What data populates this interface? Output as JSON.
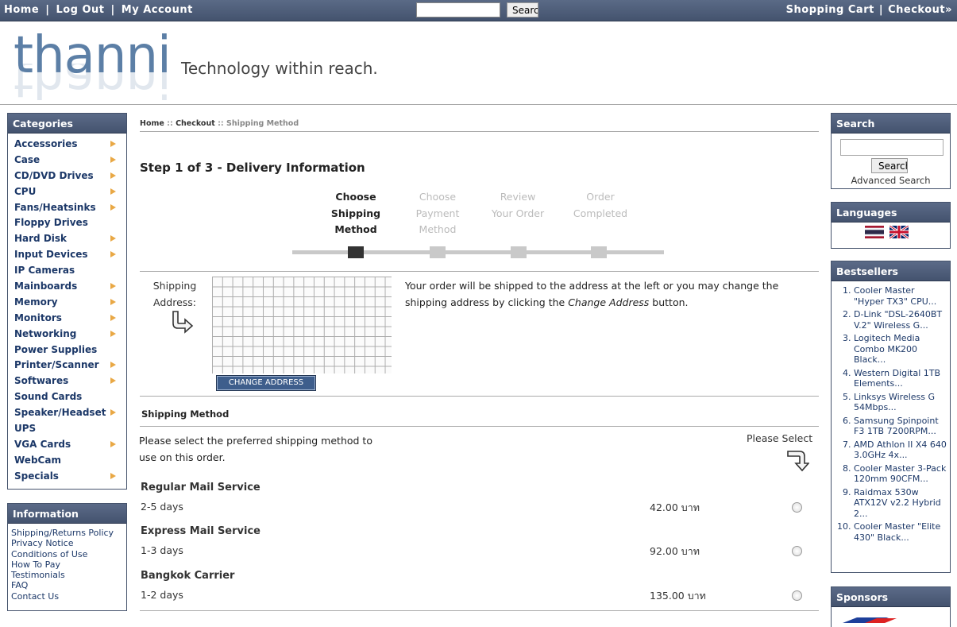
{
  "topnav": {
    "left": [
      "Home",
      "Log Out",
      "My Account"
    ],
    "search_button": "Search",
    "right": [
      "Shopping Cart",
      "Checkout»"
    ]
  },
  "header": {
    "logo": "thanni",
    "tagline": "Technology within reach."
  },
  "categories": {
    "title": "Categories",
    "items": [
      {
        "label": "Accessories",
        "arrow": true
      },
      {
        "label": "Case",
        "arrow": true
      },
      {
        "label": "CD/DVD Drives",
        "arrow": true
      },
      {
        "label": "CPU",
        "arrow": true
      },
      {
        "label": "Fans/Heatsinks",
        "arrow": true
      },
      {
        "label": "Floppy Drives",
        "arrow": false
      },
      {
        "label": "Hard Disk",
        "arrow": true
      },
      {
        "label": "Input Devices",
        "arrow": true
      },
      {
        "label": "IP Cameras",
        "arrow": false
      },
      {
        "label": "Mainboards",
        "arrow": true
      },
      {
        "label": "Memory",
        "arrow": true
      },
      {
        "label": "Monitors",
        "arrow": true
      },
      {
        "label": "Networking",
        "arrow": true
      },
      {
        "label": "Power Supplies",
        "arrow": false
      },
      {
        "label": "Printer/Scanner",
        "arrow": true
      },
      {
        "label": "Softwares",
        "arrow": true
      },
      {
        "label": "Sound Cards",
        "arrow": false
      },
      {
        "label": "Speaker/Headset",
        "arrow": true
      },
      {
        "label": "UPS",
        "arrow": false
      },
      {
        "label": "VGA Cards",
        "arrow": true
      },
      {
        "label": "WebCam",
        "arrow": false
      },
      {
        "label": "Specials",
        "arrow": true
      }
    ]
  },
  "information": {
    "title": "Information",
    "items": [
      "Shipping/Returns Policy",
      "Privacy Notice",
      "Conditions of Use",
      "How To Pay",
      "Testimonials",
      "FAQ",
      "Contact Us"
    ]
  },
  "breadcrumb": {
    "home": "Home",
    "sep": "::",
    "checkout": "Checkout",
    "current": "Shipping Method"
  },
  "main": {
    "step_title": "Step 1 of 3 - Delivery Information",
    "steps": [
      {
        "lines": [
          "Choose",
          "Shipping",
          "Method"
        ]
      },
      {
        "lines": [
          "Choose",
          "Payment",
          "Method"
        ]
      },
      {
        "lines": [
          "Review",
          "Your Order"
        ]
      },
      {
        "lines": [
          "Order",
          "Completed"
        ]
      }
    ],
    "shipping_address_label": [
      "Shipping",
      "Address:"
    ],
    "change_address": "CHANGE ADDRESS",
    "shipping_desc_pre": "Your order will be shipped to the address at the left or you may change the shipping address by clicking the ",
    "shipping_desc_em": "Change Address",
    "shipping_desc_post": " button.",
    "shipping_method_title": "Shipping Method",
    "method_desc": "Please select the preferred shipping method to use on this order.",
    "please_select": "Please Select",
    "services": [
      {
        "name": "Regular Mail Service",
        "days": "2-5 days",
        "price": "42.00 บาท"
      },
      {
        "name": "Express Mail Service",
        "days": "1-3 days",
        "price": "92.00 บาท"
      },
      {
        "name": "Bangkok Carrier",
        "days": "1-2 days",
        "price": "135.00 บาท"
      }
    ]
  },
  "side_search": {
    "title": "Search",
    "button": "Search",
    "advanced": "Advanced Search"
  },
  "languages": {
    "title": "Languages"
  },
  "bestsellers": {
    "title": "Bestsellers",
    "items": [
      "Cooler Master \"Hyper TX3\" CPU...",
      "D-Link \"DSL-2640BT V.2\" Wireless G...",
      "Logitech Media Combo MK200 Black...",
      "Western Digital 1TB Elements...",
      "Linksys Wireless G 54Mbps...",
      "Samsung Spinpoint F3 1TB 7200RPM...",
      "AMD Athlon II X4 640 3.0GHz 4x...",
      "Cooler Master 3-Pack 120mm 90CFM...",
      "Raidmax 530w ATX12V v2.2 Hybrid 2...",
      "Cooler Master \"Elite 430\" Black..."
    ]
  },
  "sponsors": {
    "title": "Sponsors"
  },
  "colors": {
    "nav_bg": "#4c5b77",
    "link": "#1c3868",
    "arrow": "#e9a845",
    "logo": "#5c7fa6"
  }
}
